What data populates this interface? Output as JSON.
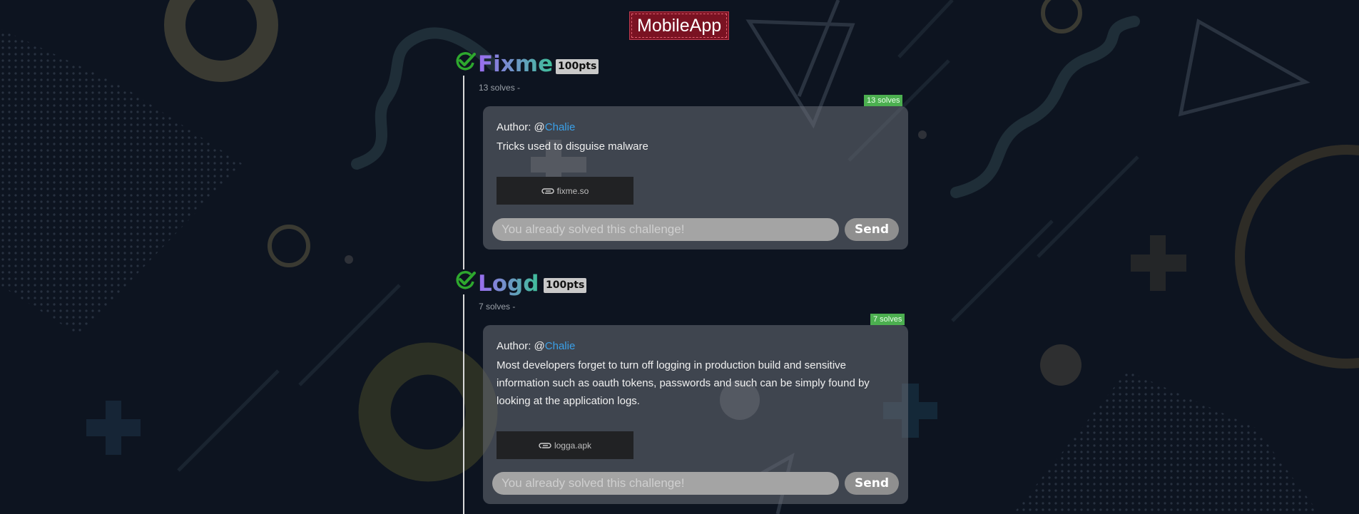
{
  "category": {
    "title": "MobileApp"
  },
  "challenges": [
    {
      "name": "Fixme",
      "points": "100pts",
      "solves_line": "13 solves -",
      "solves_badge": "13 solves",
      "author_prefix": "Author: @",
      "author_name": "Chalie",
      "description": "Tricks used to disguise malware",
      "file": {
        "icon": "paperclip-icon",
        "name": "fixme.so"
      },
      "flag_placeholder": "You already solved this challenge!",
      "send_label": "Send",
      "status_icon": "check-icon"
    },
    {
      "name": "Logd",
      "points": "100pts",
      "solves_line": "7 solves -",
      "solves_badge": "7 solves",
      "author_prefix": "Author: @",
      "author_name": "Chalie",
      "description": "Most developers forget to turn off logging in production build and sensitive information such as oauth tokens, passwords and such can be simply found by looking at the application logs.",
      "file": {
        "icon": "paperclip-icon",
        "name": "logga.apk"
      },
      "flag_placeholder": "You already solved this challenge!",
      "send_label": "Send",
      "status_icon": "check-icon"
    }
  ],
  "colors": {
    "background": "#0d1420",
    "category_bg": "#7a1222",
    "solved_green": "#4caf50",
    "author_link": "#3aa0e8",
    "check_green": "#2ea82e"
  }
}
